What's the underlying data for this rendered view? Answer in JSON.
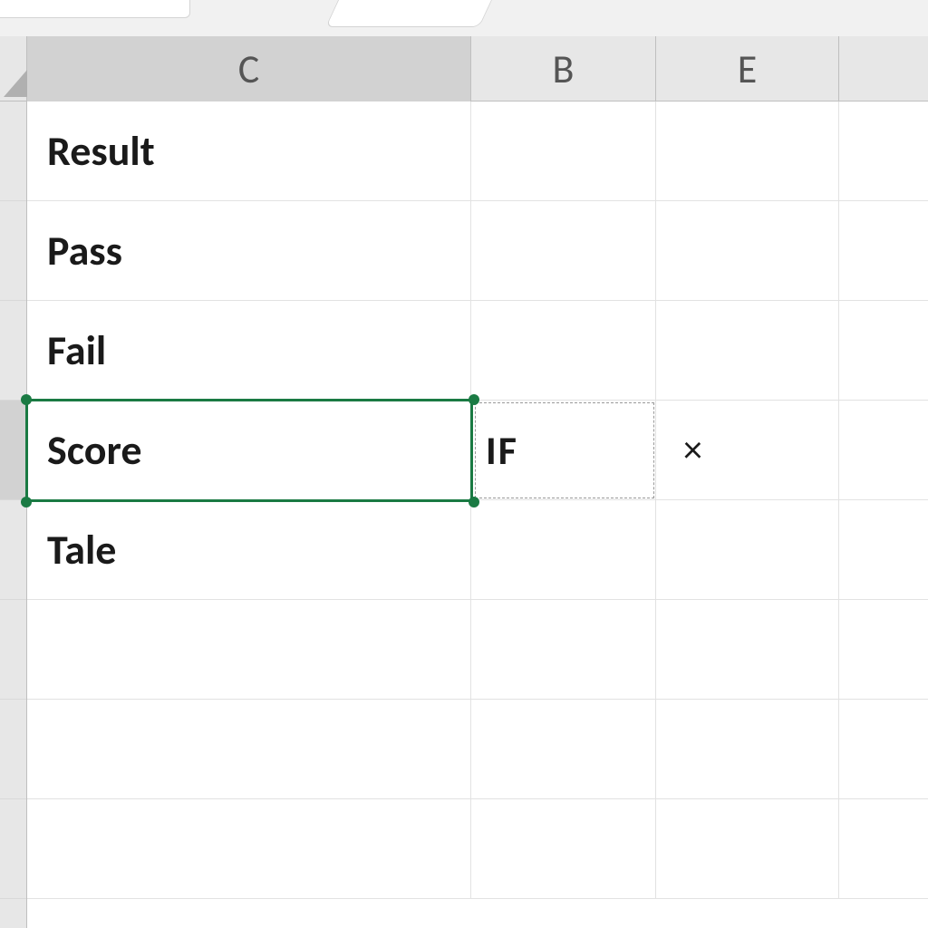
{
  "columns": {
    "c": "C",
    "b": "B",
    "e": "E"
  },
  "rows": {
    "r1": {
      "c": "Result",
      "b": "",
      "e": ""
    },
    "r2": {
      "c": "Pass",
      "b": "",
      "e": ""
    },
    "r3": {
      "c": "Fail",
      "b": "",
      "e": ""
    },
    "r4": {
      "c": "Score",
      "b": "IF",
      "e": "×"
    },
    "r5": {
      "c": "Tale",
      "b": "",
      "e": ""
    }
  },
  "selection": {
    "active_cell": "C4",
    "colors": {
      "selection_border": "#1a7a43"
    }
  }
}
